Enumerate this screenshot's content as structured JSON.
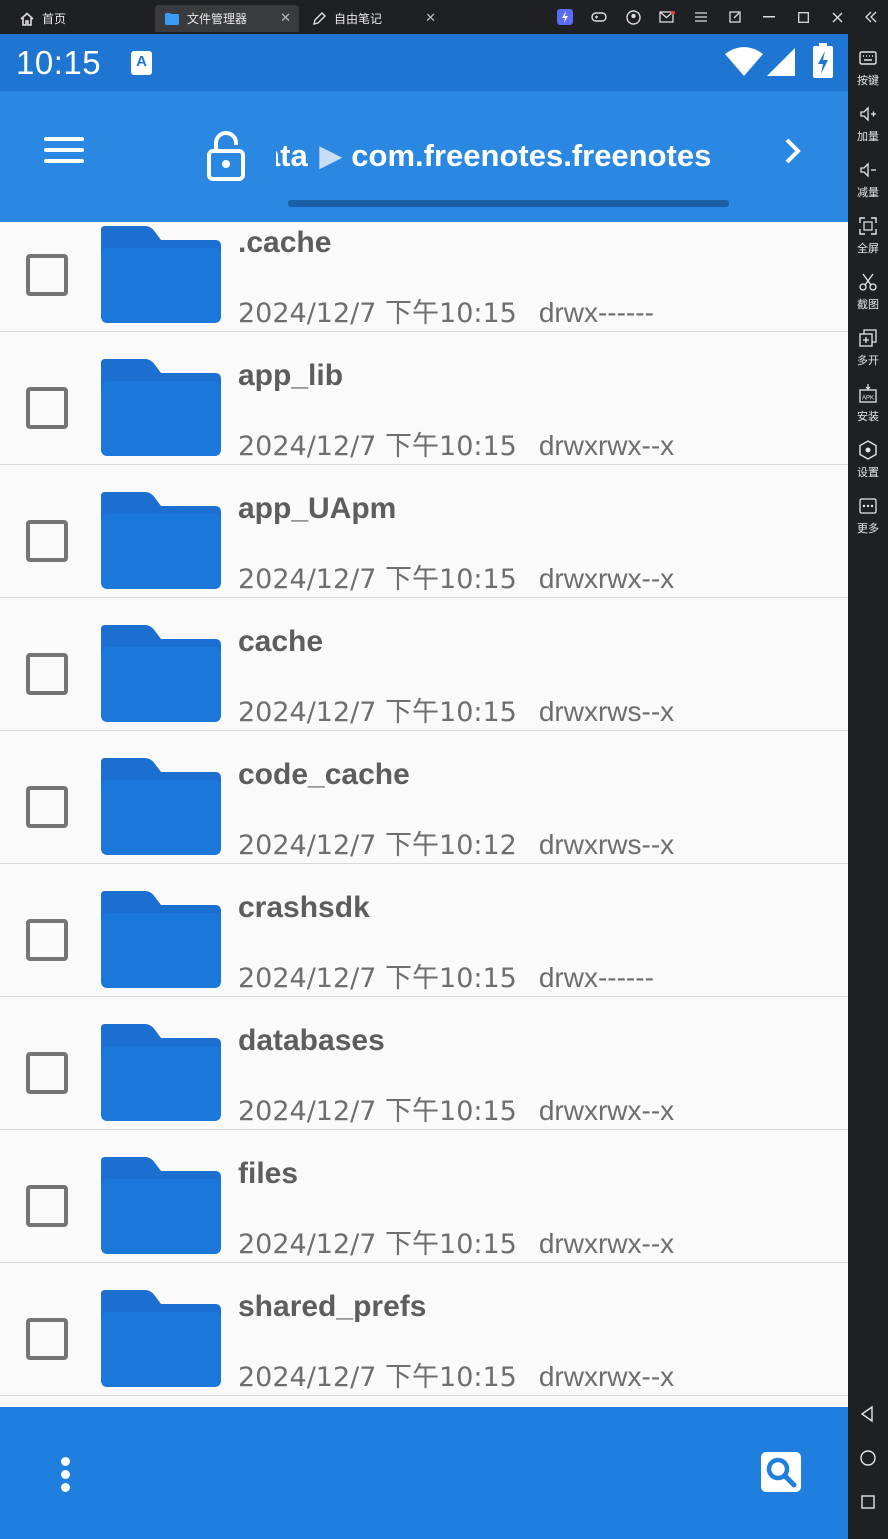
{
  "emulator_tabs": [
    {
      "label": "首页",
      "icon": "home-icon",
      "active": false
    },
    {
      "label": "文件管理器",
      "icon": "folder-app-icon",
      "active": true
    },
    {
      "label": "自由笔记",
      "icon": "pen-app-icon",
      "active": false
    }
  ],
  "status_bar": {
    "time": "10:15",
    "badge": "A"
  },
  "appbar": {
    "crumb_prev": "data",
    "crumb_current": "com.freenotes.freenotes"
  },
  "files": [
    {
      "name": ".cache",
      "date": "2024/12/7 下午10:15",
      "perm": "drwx------"
    },
    {
      "name": "app_lib",
      "date": "2024/12/7 下午10:15",
      "perm": "drwxrwx--x"
    },
    {
      "name": "app_UApm",
      "date": "2024/12/7 下午10:15",
      "perm": "drwxrwx--x"
    },
    {
      "name": "cache",
      "date": "2024/12/7 下午10:15",
      "perm": "drwxrws--x"
    },
    {
      "name": "code_cache",
      "date": "2024/12/7 下午10:12",
      "perm": "drwxrws--x"
    },
    {
      "name": "crashsdk",
      "date": "2024/12/7 下午10:15",
      "perm": "drwx------"
    },
    {
      "name": "databases",
      "date": "2024/12/7 下午10:15",
      "perm": "drwxrwx--x"
    },
    {
      "name": "files",
      "date": "2024/12/7 下午10:15",
      "perm": "drwxrwx--x"
    },
    {
      "name": "shared_prefs",
      "date": "2024/12/7 下午10:15",
      "perm": "drwxrwx--x"
    }
  ],
  "sidebar": [
    {
      "label": "按键",
      "icon": "keyboard-icon"
    },
    {
      "label": "加量",
      "icon": "volume-up-icon"
    },
    {
      "label": "减量",
      "icon": "volume-down-icon"
    },
    {
      "label": "全屏",
      "icon": "fullscreen-icon"
    },
    {
      "label": "截图",
      "icon": "scissors-icon"
    },
    {
      "label": "多开",
      "icon": "multi-instance-icon"
    },
    {
      "label": "安装",
      "icon": "apk-install-icon"
    },
    {
      "label": "设置",
      "icon": "settings-icon"
    },
    {
      "label": "更多",
      "icon": "more-icon"
    }
  ],
  "colors": {
    "status_bar": "#1e76d2",
    "app_bar": "#2a88e2",
    "bottom_bar": "#1e7fdf",
    "folder": "#1a6fd0",
    "text_primary": "#5d5d5d"
  }
}
